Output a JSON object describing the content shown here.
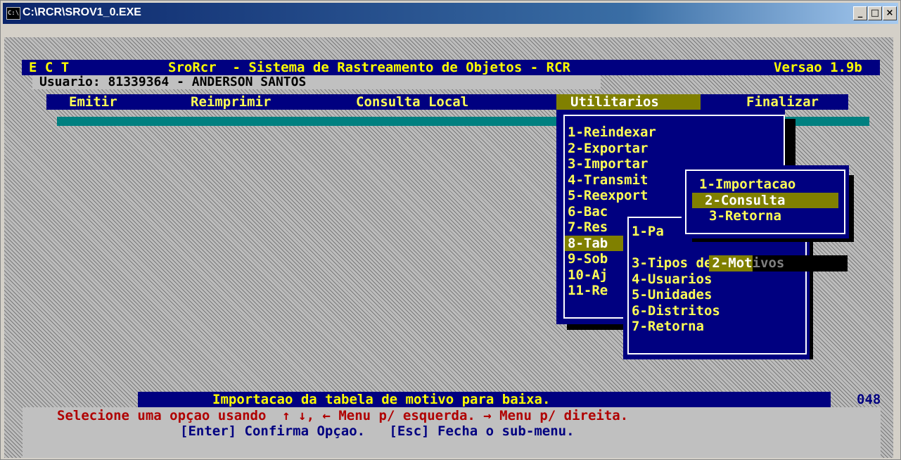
{
  "window": {
    "title": "C:\\RCR\\SROV1_0.EXE",
    "icon_text": "C:\\",
    "controls": {
      "minimize": "_",
      "maximize": "□",
      "close": "×"
    }
  },
  "header": {
    "org": "E C T",
    "system": "SroRcr  - Sistema de Rastreamento de Objetos - RCR",
    "version": "Versao 1.9b",
    "user_label": "Usuario: 81339364 - ANDERSON SANTOS"
  },
  "menubar": {
    "items": [
      {
        "label": "Emitir"
      },
      {
        "label": "Reimprimir"
      },
      {
        "label": "Consulta Local"
      },
      {
        "label": "Utilitarios"
      },
      {
        "label": "Finalizar"
      }
    ],
    "active_index": 3
  },
  "utilitarios_menu": {
    "items": [
      "1-Reindexar",
      "2-Exportar",
      "3-Importar",
      "4-Transmit",
      "5-Reexport",
      "6-Bac",
      "7-Res",
      "8-Tab",
      "9-Sob",
      "10-Aj",
      "11-Re"
    ]
  },
  "tabelas_submenu": {
    "items": [
      "1-Pa",
      "2-Motivos",
      "3-Tipos de doc",
      "4-Usuarios",
      "5-Unidades",
      "6-Distritos",
      "7-Retorna"
    ],
    "motivos_highlight_part": "2-Mot",
    "motivos_rest_part": "ivos"
  },
  "motivos_submenu": {
    "items": [
      "1-Importacao",
      "2-Consulta",
      "3-Retorna"
    ],
    "selected_index": 1
  },
  "status": {
    "message": "Importacao da tabela de motivo para baixa.",
    "code": "048"
  },
  "help": {
    "line1": "Selecione uma opçao usando  ↑ ↓, ← Menu p/ esquerda. → Menu p/ direita.",
    "line2": "[Enter] Confirma Opçao.   [Esc] Fecha o sub-menu."
  },
  "colors": {
    "console_bg": "#000080",
    "menu_text": "#ffff55",
    "highlight": "#808000",
    "teal_bar": "#008080",
    "help_text": "#b00000"
  }
}
